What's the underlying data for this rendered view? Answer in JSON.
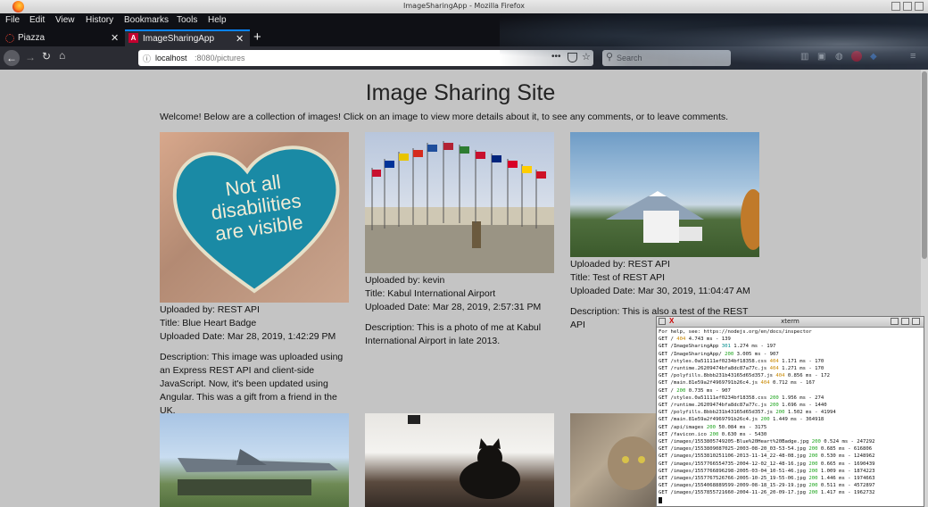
{
  "window": {
    "title": "ImageSharingApp - Mozilla Firefox"
  },
  "menu": [
    "File",
    "Edit",
    "View",
    "History",
    "Bookmarks",
    "Tools",
    "Help"
  ],
  "tabs": [
    {
      "label": "Piazza",
      "active": false
    },
    {
      "label": "ImageSharingApp",
      "active": true
    }
  ],
  "urlbar": {
    "host": "localhost",
    "rest": ":8080/pictures"
  },
  "search": {
    "placeholder": "Search"
  },
  "page": {
    "title": "Image Sharing Site",
    "welcome": "Welcome! Below are a collection of images! Click on an image to view more details about it, to see any comments, or to leave comments."
  },
  "cards": [
    {
      "uploader": "Uploaded by: REST API",
      "title": "Title: Blue Heart Badge",
      "date": "Uploaded Date: Mar 28, 2019, 1:42:29 PM",
      "description": "Description: This image was uploaded using an Express REST API and client-side JavaScript. Now, it's been updated using Angular. This was a gift from a friend in the UK.",
      "badge_text": [
        "Not all",
        "disabilities",
        "are visible"
      ]
    },
    {
      "uploader": "Uploaded by: kevin",
      "title": "Title: Kabul International Airport",
      "date": "Uploaded Date: Mar 28, 2019, 2:57:31 PM",
      "description": "Description: This is a photo of me at Kabul International Airport in late 2013."
    },
    {
      "uploader": "Uploaded by: REST API",
      "title": "Title: Test of REST API",
      "date": "Uploaded Date: Mar 30, 2019, 11:04:47 AM",
      "description": "Description: This is also a test of the REST API"
    }
  ],
  "xterm": {
    "title": "xterm",
    "lines": [
      {
        "t": "For help, see: https://nodejs.org/en/docs/inspector"
      },
      {
        "t": "GET / ",
        "s": "404",
        "c": "orange",
        "r": " 4.743 ms - 139"
      },
      {
        "t": "GET /ImageSharingApp ",
        "s": "301",
        "c": "cyan",
        "r": " 1.274 ms - 197"
      },
      {
        "t": "GET /ImageSharingApp/ ",
        "s": "200",
        "c": "green",
        "r": " 3.005 ms - 907"
      },
      {
        "t": "GET /styles.0a51111ef0234bf18358.css ",
        "s": "404",
        "c": "orange",
        "r": " 1.171 ms - 170"
      },
      {
        "t": "GET /runtime.26209474bfa8dc87a77c.js ",
        "s": "404",
        "c": "orange",
        "r": " 1.271 ms - 170"
      },
      {
        "t": "GET /polyfills.8bbb231b43165d65d357.js ",
        "s": "404",
        "c": "orange",
        "r": " 0.856 ms - 172"
      },
      {
        "t": "GET /main.81e59a2f4969791b26c4.js ",
        "s": "404",
        "c": "orange",
        "r": " 0.712 ms - 167"
      },
      {
        "t": "GET / ",
        "s": "200",
        "c": "green",
        "r": " 0.735 ms - 907"
      },
      {
        "t": "GET /styles.0a51111ef0234bf18358.css ",
        "s": "200",
        "c": "green",
        "r": " 1.956 ms - 274"
      },
      {
        "t": "GET /runtime.26209474bfa8dc87a77c.js ",
        "s": "200",
        "c": "green",
        "r": " 1.696 ms - 1440"
      },
      {
        "t": "GET /polyfills.8bbb231b43165d65d357.js ",
        "s": "200",
        "c": "green",
        "r": " 1.502 ms - 41994"
      },
      {
        "t": "GET /main.81e59a2f4969791b26c4.js ",
        "s": "200",
        "c": "green",
        "r": " 1.449 ms - 364918"
      },
      {
        "t": "GET /api/images ",
        "s": "200",
        "c": "green",
        "r": " 50.084 ms - 3175"
      },
      {
        "t": "GET /favicon.ico ",
        "s": "200",
        "c": "green",
        "r": " 0.630 ms - 5430"
      },
      {
        "t": "GET /images/1553805749205-Blue%20Heart%20Badge.jpg ",
        "s": "200",
        "c": "green",
        "r": " 0.524 ms - 247292"
      },
      {
        "t": "GET /images/1553809087025-2003-08-20_03-53-54.jpg ",
        "s": "200",
        "c": "green",
        "r": " 0.685 ms - 616806"
      },
      {
        "t": "GET /images/1553810251106-2013-11-14_22-48-08.jpg ",
        "s": "200",
        "c": "green",
        "r": " 0.530 ms - 1248962"
      },
      {
        "t": "GET /images/1557766554735-2004-12-02_12-48-16.jpg ",
        "s": "200",
        "c": "green",
        "r": " 0.665 ms - 1690439"
      },
      {
        "t": "GET /images/1557766896298-2005-03-04_10-51-46.jpg ",
        "s": "200",
        "c": "green",
        "r": " 1.009 ms - 1874223"
      },
      {
        "t": "GET /images/1557767526766-2005-10-25_19-55-06.jpg ",
        "s": "200",
        "c": "green",
        "r": " 1.446 ms - 1974663"
      },
      {
        "t": "GET /images/1554068889599-2009-08-18_15-29-19.jpg ",
        "s": "200",
        "c": "green",
        "r": " 0.511 ms - 4572897"
      },
      {
        "t": "GET /images/1557855721660-2004-11-26_20-09-17.jpg ",
        "s": "200",
        "c": "green",
        "r": " 1.417 ms - 1962732"
      }
    ]
  }
}
